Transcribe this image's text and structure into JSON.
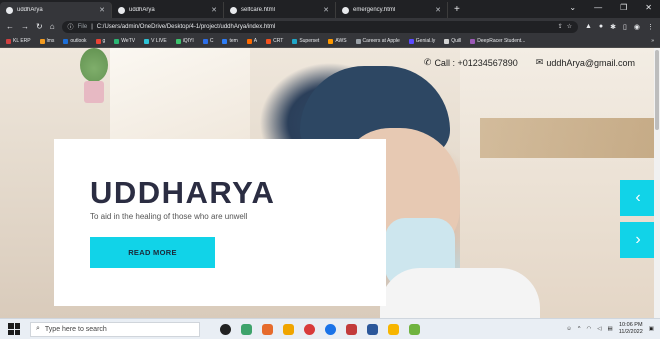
{
  "browser": {
    "tabs": [
      {
        "label": "uddhArya",
        "active": true
      },
      {
        "label": "uddhArya",
        "active": false
      },
      {
        "label": "selfcare.html",
        "active": false
      },
      {
        "label": "emergency.html",
        "active": false
      }
    ],
    "new_tab": "+",
    "url_prefix": "File",
    "url": "C:/Users/admin/OneDrive/Desktop/4-1/project/uddhArya/index.html",
    "bookmarks": [
      {
        "label": "KL ERP",
        "color": "#d04040"
      },
      {
        "label": "lms",
        "color": "#f29b20"
      },
      {
        "label": "outlook",
        "color": "#1d6fd8"
      },
      {
        "label": "g",
        "color": "#ea4335"
      },
      {
        "label": "WeTV",
        "color": "#2bb673"
      },
      {
        "label": "V LIVE",
        "color": "#2ec4d6"
      },
      {
        "label": "iQIYI",
        "color": "#3ec46d"
      },
      {
        "label": "C",
        "color": "#2c6ee8"
      },
      {
        "label": "tem",
        "color": "#2d7df6"
      },
      {
        "label": "A",
        "color": "#ff6a00"
      },
      {
        "label": "CRT",
        "color": "#f4511e"
      },
      {
        "label": "Superset",
        "color": "#20a7c9"
      },
      {
        "label": "AWS",
        "color": "#ff9900"
      },
      {
        "label": "Careers at Apple",
        "color": "#9aa0a6"
      },
      {
        "label": "Genial.ly",
        "color": "#5b4bff"
      },
      {
        "label": "Quill",
        "color": "#d4d4d4"
      },
      {
        "label": "DeepRacer Student...",
        "color": "#9b59b6"
      }
    ],
    "bookmarks_more": "»"
  },
  "header": {
    "call_label": "Call : +01234567890",
    "email_label": "uddhArya@gmail.com"
  },
  "hero": {
    "title": "UDDHARYA",
    "subtitle": "To aid in the healing of those who are unwell",
    "button_label": "READ MORE",
    "accent_color": "#11d3e8"
  },
  "carousel": {
    "prev_icon": "chevron-left-icon",
    "next_icon": "chevron-right-icon"
  },
  "taskbar": {
    "search_placeholder": "Type here to search",
    "time": "10:06 PM",
    "date": "11/2/2022"
  }
}
